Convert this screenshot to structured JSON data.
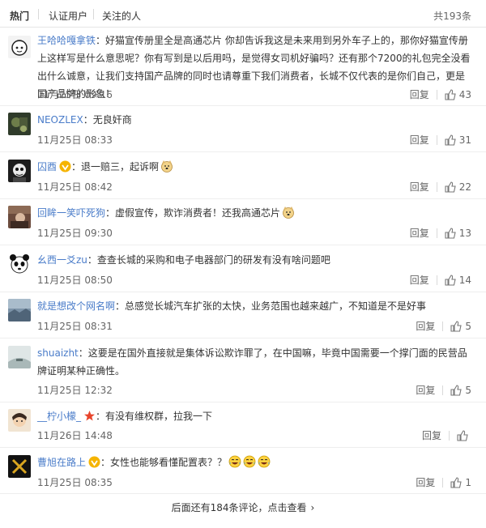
{
  "tabs": [
    {
      "label": "热门",
      "active": true
    },
    {
      "label": "认证用户",
      "active": false
    },
    {
      "label": "关注的人",
      "active": false
    }
  ],
  "total": "共193条",
  "reply_label": "回复",
  "more": "后面还有184条评论，点击查看",
  "comments": [
    {
      "user": "王哈哈嘎拿铁",
      "text": "好猫宣传册里全是高通芯片 你却告诉我这是未来用到另外车子上的，那你好猫宣传册上这样写是什么意思呢？你有写到是以后用吗，是觉得女司机好骗吗？还有那个7200的礼包完全没看出什么诚意，让我们支持国产品牌的同时也请尊重下我们消费者，长城不仅代表的是你们自己，更是国产品牌的形象！",
      "time": "11月25日 09:16",
      "likes": "43"
    },
    {
      "user": "NEOZLEX",
      "text": "无良奸商",
      "time": "11月25日 08:33",
      "likes": "31"
    },
    {
      "user": "囚酉",
      "text": "退一赔三，起诉啊",
      "time": "11月25日 08:42",
      "likes": "22"
    },
    {
      "user": "回眸一笑吓死狗",
      "text": "虚假宣传，欺诈消费者！还我高通芯片",
      "time": "11月25日 09:30",
      "likes": "13"
    },
    {
      "user": "幺西一爻zu",
      "text": "查查长城的采购和电子电器部门的研发有没有啥问题吧",
      "time": "11月25日 08:50",
      "likes": "14"
    },
    {
      "user": "就是想改个网名啊",
      "text": "总感觉长城汽车扩张的太快，业务范围也越来越广，不知道是不是好事",
      "time": "11月25日 08:31",
      "likes": "5"
    },
    {
      "user": "shuaizht",
      "text": "这要是在国外直接就是集体诉讼欺诈罪了，在中国嘛，毕竟中国需要一个撑门面的民营品牌证明某种正确性。",
      "time": "11月25日 12:32",
      "likes": "5"
    },
    {
      "user": "__柠小檬_",
      "text": "有没有维权群，拉我一下",
      "time": "11月26日 14:48",
      "likes": ""
    },
    {
      "user": "曹旭在路上",
      "text": "女性也能够看懂配置表？？",
      "time": "11月25日 08:35",
      "likes": "1"
    }
  ],
  "colors": {
    "link": "#4a7cc9",
    "badge": "#f5b400",
    "star": "#e8452c"
  }
}
